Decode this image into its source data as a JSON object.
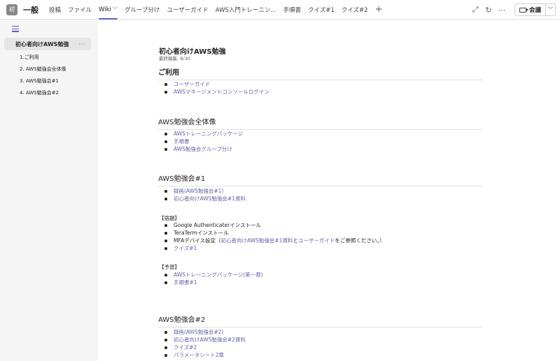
{
  "header": {
    "team_initial": "初",
    "channel": "一般",
    "tabs": [
      {
        "label": "投稿"
      },
      {
        "label": "ファイル"
      },
      {
        "label": "Wiki"
      },
      {
        "label": "グループ分け"
      },
      {
        "label": "ユーザーガイド"
      },
      {
        "label": "AWS入門トレーニン..."
      },
      {
        "label": "手順書"
      },
      {
        "label": "クイズ#1"
      },
      {
        "label": "クイズ#2"
      }
    ],
    "add_tab": "+",
    "meeting_label": "会議",
    "icons": [
      "expand-icon",
      "refresh-icon",
      "more-icon",
      "camera-icon",
      "chevron-down-icon"
    ]
  },
  "sidebar": {
    "parent": "初心者向けAWS勉強",
    "more": "···",
    "children": [
      "1.ご利用",
      "2. AWS勉強会全体像",
      "3. AWS勉強会#1",
      "4. AWS勉強会#2"
    ]
  },
  "page": {
    "title": "初心者向けAWS勉強",
    "last_edited": "最終編集: 8/30",
    "sections": {
      "usage": {
        "heading": "ご利用",
        "items": [
          "ユーザーガイド",
          "AWSマネージメントコンソールログイン"
        ]
      },
      "overview": {
        "heading": "AWS勉強会全体像",
        "items": [
          "AWSトレーニングパッケージ",
          "手順書",
          "AWS勉強会グループ分け"
        ]
      },
      "s1": {
        "heading": "AWS勉強会#1",
        "items": [
          "録画(AWS勉強会#1)",
          "初心者向けAWS勉強会#1資料"
        ],
        "homework_label": "【宿題】",
        "homework": {
          "i1": "Google Authenticaterインストール",
          "i2": "TeraTermインストール",
          "i3_prefix": "MFAデバイス設定（",
          "i3_link1": "初心者向けAWS勉強会#1資料",
          "i3_mid": "と",
          "i3_link2": "ユーザーガイド",
          "i3_suffix": "をご参照ください。）",
          "i4": "クイズ#1"
        },
        "prep_label": "【予習】",
        "prep": [
          "AWSトレーニングパッケージ(第一章)",
          "手順書#1"
        ]
      },
      "s2": {
        "heading": "AWS勉強会#2",
        "items": [
          "録画(AWS勉強会#2)",
          "初心者向けAWS勉強会#2資料",
          "クイズ#2",
          "パラメータシート2章"
        ]
      }
    }
  },
  "colors": {
    "accent": "#5b5fc7",
    "link": "#6264a7"
  }
}
